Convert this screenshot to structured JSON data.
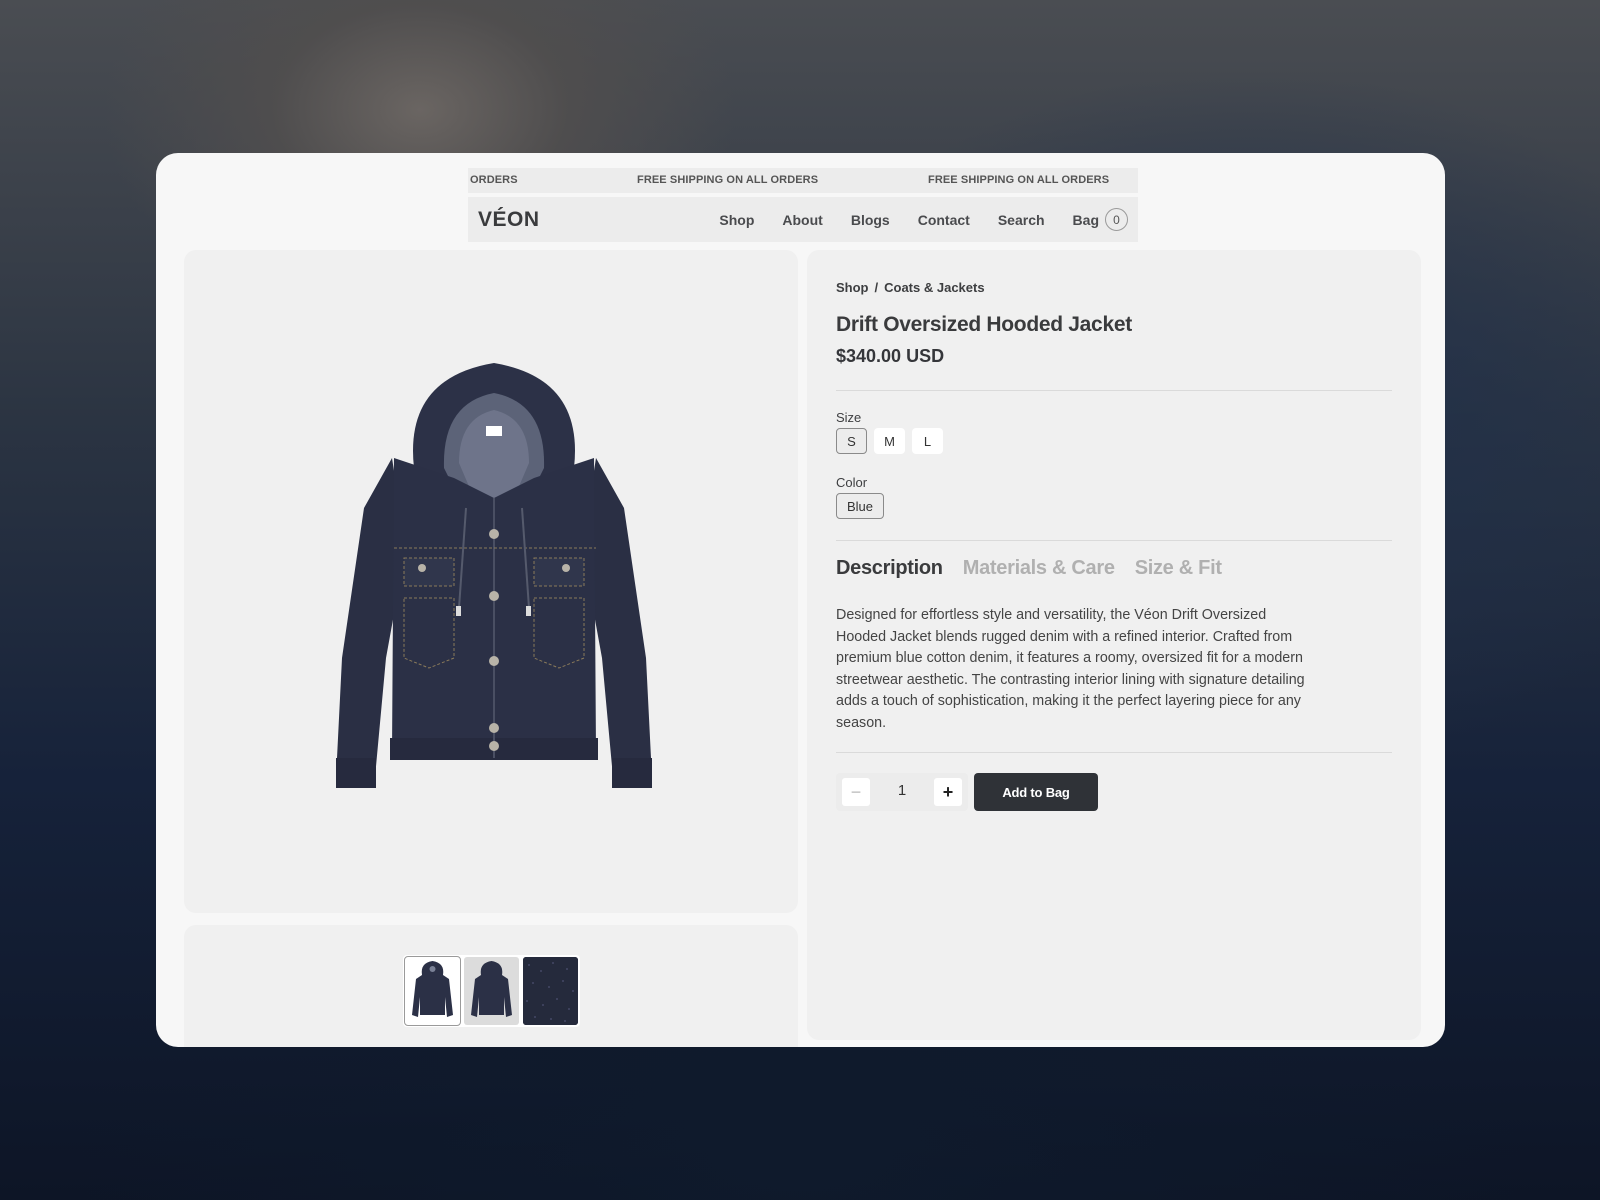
{
  "announcement": {
    "items": [
      "ORDERS",
      "FREE SHIPPING ON ALL ORDERS",
      "FREE SHIPPING ON ALL ORDERS"
    ]
  },
  "nav": {
    "logo": "VÉON",
    "links": [
      "Shop",
      "About",
      "Blogs",
      "Contact",
      "Search"
    ],
    "bag_label": "Bag",
    "bag_count": "0"
  },
  "gallery": {
    "main_image": "denim-hooded-jacket",
    "thumbnails": [
      "jacket-front",
      "jacket-back",
      "denim-texture"
    ],
    "selected_thumbnail": 0
  },
  "product": {
    "breadcrumb": {
      "root": "Shop",
      "separator": "/",
      "category": "Coats & Jackets"
    },
    "title": "Drift Oversized Hooded Jacket",
    "price": "$340.00 USD",
    "size": {
      "label": "Size",
      "options": [
        "S",
        "M",
        "L"
      ],
      "selected": "S"
    },
    "color": {
      "label": "Color",
      "options": [
        "Blue"
      ],
      "selected": "Blue"
    },
    "tabs": [
      "Description",
      "Materials & Care",
      "Size & Fit"
    ],
    "active_tab": "Description",
    "description": "Designed for effortless style and versatility, the Véon Drift Oversized Hooded Jacket blends rugged denim with a refined interior. Crafted from premium blue cotton denim, it features a roomy, oversized fit for a modern streetwear aesthetic. The contrasting interior lining with signature detailing adds a touch of sophistication, making it the perfect layering piece for any season.",
    "quantity": "1",
    "minus_symbol": "−",
    "plus_symbol": "+",
    "add_to_bag": "Add to Bag"
  },
  "colors": {
    "window_bg": "#f7f7f7",
    "panel_bg": "#f0f0f0",
    "denim": "#2b3046",
    "button_dark": "#2f3237"
  }
}
